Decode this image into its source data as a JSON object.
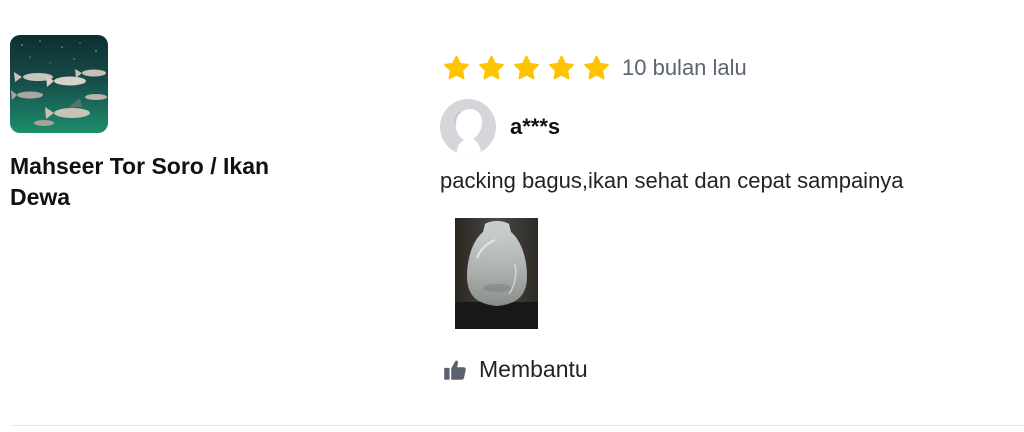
{
  "product": {
    "name": "Mahseer Tor Soro / Ikan Dewa"
  },
  "review": {
    "rating": 5,
    "rating_max": 5,
    "time": "10 bulan lalu",
    "username": "a***s",
    "text": "packing bagus,ikan sehat dan cepat sampainya",
    "helpful_label": "Membantu"
  },
  "colors": {
    "star": "#ffc400",
    "muted_text": "#5b6470",
    "avatar_bg": "#d4d6da",
    "thumb_icon": "#5a6272"
  },
  "icons": {
    "star": "star-icon",
    "avatar": "avatar-placeholder-icon",
    "helpful": "thumbs-up-icon"
  }
}
